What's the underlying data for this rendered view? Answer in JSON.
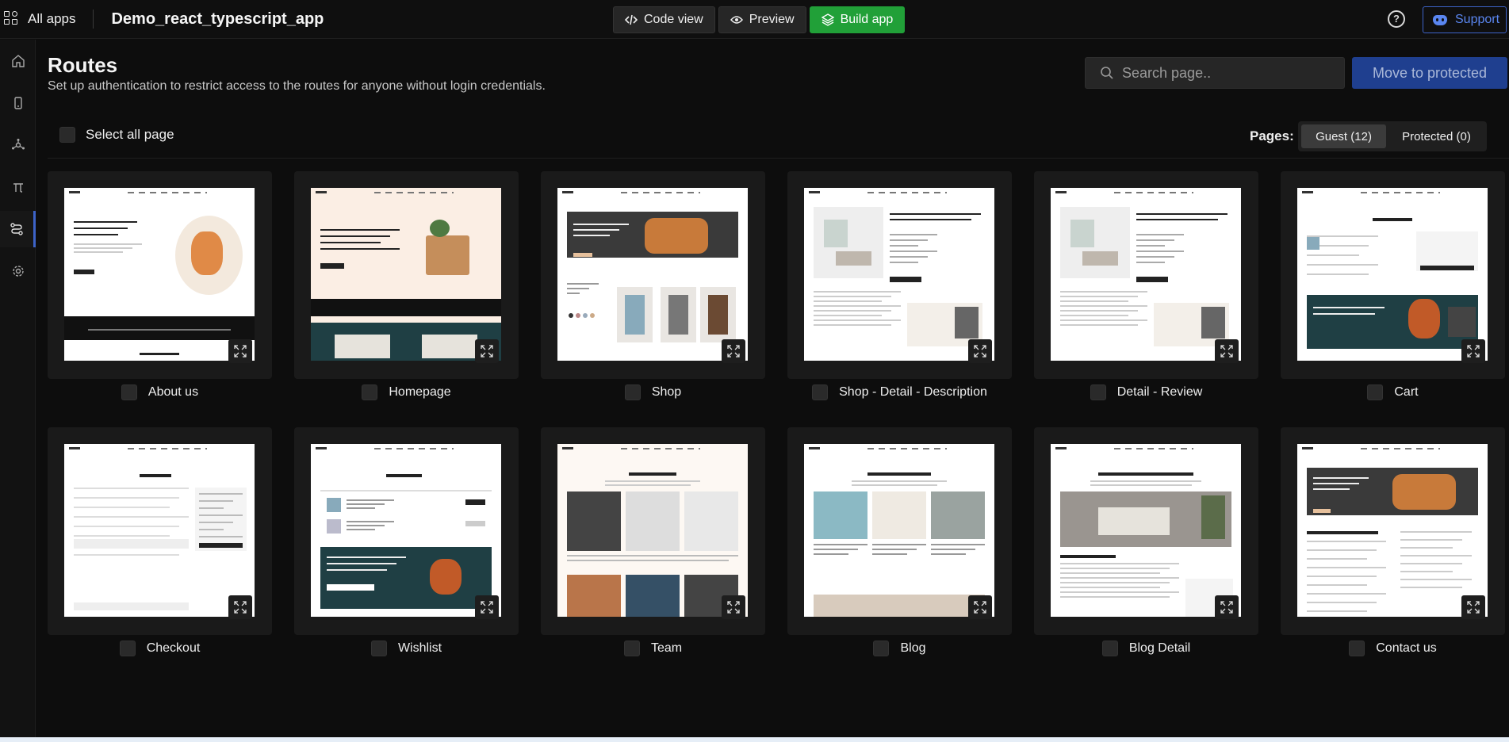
{
  "topbar": {
    "all_apps": "All apps",
    "app_title": "Demo_react_typescript_app",
    "code_view": "Code view",
    "preview": "Preview",
    "build_app": "Build app",
    "support": "Support",
    "help": "?"
  },
  "main": {
    "title": "Routes",
    "description": "Set up authentication to restrict access to the routes for anyone without login credentials.",
    "search_placeholder": "Search page..",
    "move_button": "Move to protected",
    "select_all": "Select all page",
    "pages_label": "Pages:",
    "tabs": [
      {
        "label": "Guest (12)",
        "selected": true
      },
      {
        "label": "Protected (0)",
        "selected": false
      }
    ]
  },
  "pages": [
    {
      "name": "About us",
      "theme": "about"
    },
    {
      "name": "Homepage",
      "theme": "home"
    },
    {
      "name": "Shop",
      "theme": "shop"
    },
    {
      "name": "Shop - Detail - Description",
      "theme": "detail"
    },
    {
      "name": "Detail - Review",
      "theme": "detail"
    },
    {
      "name": "Cart",
      "theme": "cart"
    },
    {
      "name": "Checkout",
      "theme": "checkout"
    },
    {
      "name": "Wishlist",
      "theme": "wishlist"
    },
    {
      "name": "Team",
      "theme": "team"
    },
    {
      "name": "Blog",
      "theme": "blog"
    },
    {
      "name": "Blog Detail",
      "theme": "blogdetail"
    },
    {
      "name": "Contact us",
      "theme": "contact"
    }
  ],
  "colors": {
    "accent": "#3d63c8",
    "build": "#21a038",
    "background": "#0d0d0d"
  }
}
